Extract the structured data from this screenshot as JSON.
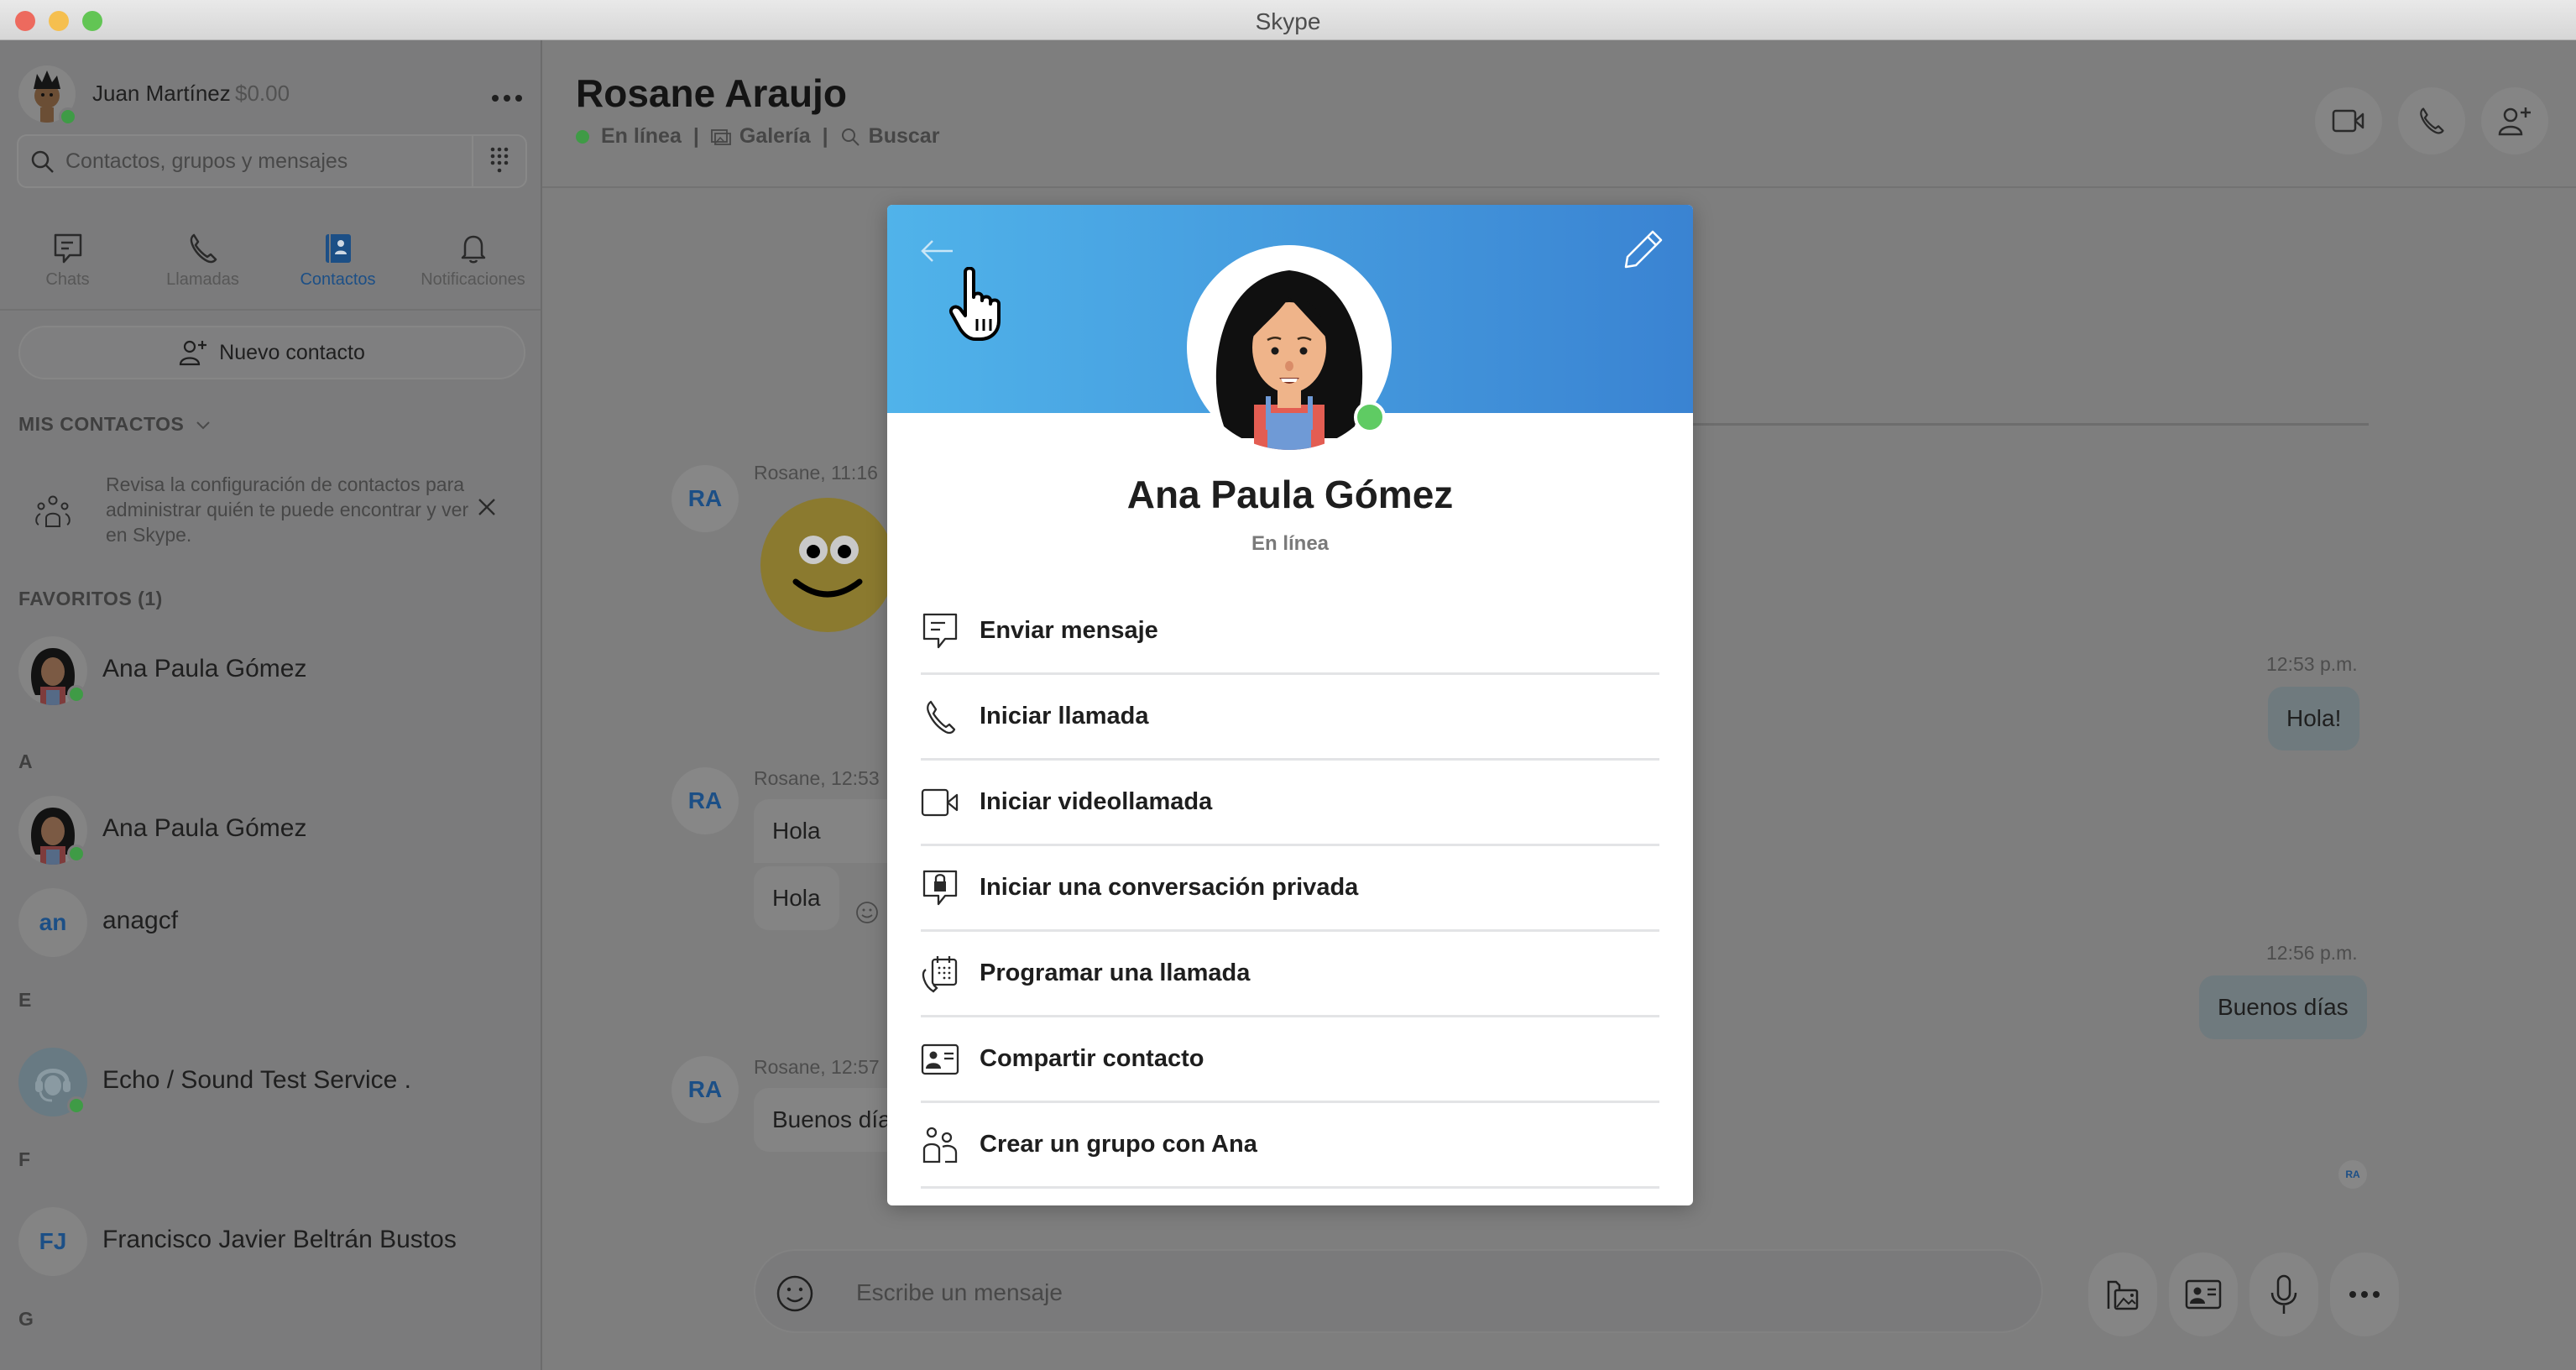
{
  "window": {
    "title": "Skype"
  },
  "sidebar": {
    "user": {
      "name": "Juan Martínez",
      "credit": "$0.00",
      "status": "online",
      "more_icon": "more-horizontal-icon"
    },
    "search": {
      "placeholder": "Contactos, grupos y mensajes",
      "value": ""
    },
    "tabs": [
      {
        "label": "Chats",
        "icon": "chat-icon",
        "active": false
      },
      {
        "label": "Llamadas",
        "icon": "phone-icon",
        "active": false
      },
      {
        "label": "Contactos",
        "icon": "contacts-book-icon",
        "active": true
      },
      {
        "label": "Notificaciones",
        "icon": "bell-icon",
        "active": false
      }
    ],
    "new_contact_label": "Nuevo contacto",
    "my_contacts_label": "MIS CONTACTOS",
    "notice_text": "Revisa la configuración de contactos para administrar quién te puede encontrar y ver en Skype.",
    "favorites_label": "FAVORITOS (1)",
    "favorites": [
      {
        "name": "Ana Paula Gómez",
        "online": true
      }
    ],
    "groups": [
      {
        "letter": "A",
        "contacts": [
          {
            "name": "Ana Paula Gómez",
            "online": true,
            "avatar": "image"
          },
          {
            "name": "anagcf",
            "online": false,
            "initials": "an"
          }
        ]
      },
      {
        "letter": "E",
        "contacts": [
          {
            "name": "Echo / Sound Test Service .",
            "online": true,
            "avatar": "headset"
          }
        ]
      },
      {
        "letter": "F",
        "contacts": [
          {
            "name": "Francisco Javier Beltrán Bustos",
            "online": false,
            "initials": "FJ"
          }
        ]
      },
      {
        "letter": "G",
        "contacts": []
      }
    ]
  },
  "chat": {
    "title": "Rosane Araujo",
    "status": "En línea",
    "gallery_label": "Galería",
    "search_label": "Buscar",
    "separator": "|",
    "header_actions": [
      "video-call",
      "audio-call",
      "add-person"
    ],
    "messages": [
      {
        "sender": "Rosane",
        "initials": "RA",
        "meta": "Rosane, 11:16",
        "type": "emoji"
      },
      {
        "sender": "me",
        "meta": "12:53 p.m.",
        "text": "Hola!"
      },
      {
        "sender": "Rosane",
        "initials": "RA",
        "meta": "Rosane, 12:53",
        "texts": [
          "Hola",
          "Hola"
        ]
      },
      {
        "sender": "me",
        "meta": "12:56 p.m.",
        "text": "Buenos días"
      },
      {
        "sender": "Rosane",
        "initials": "RA",
        "meta": "Rosane, 12:57",
        "text": "Buenos días"
      }
    ],
    "read_receipt": "RA",
    "composer_placeholder": "Escribe un mensaje"
  },
  "profile_modal": {
    "name": "Ana Paula Gómez",
    "status": "En línea",
    "actions": [
      {
        "label": "Enviar mensaje",
        "icon": "chat-icon"
      },
      {
        "label": "Iniciar llamada",
        "icon": "phone-icon"
      },
      {
        "label": "Iniciar videollamada",
        "icon": "video-icon"
      },
      {
        "label": "Iniciar una conversación privada",
        "icon": "private-chat-lock-icon"
      },
      {
        "label": "Programar una llamada",
        "icon": "schedule-call-icon"
      },
      {
        "label": "Compartir contacto",
        "icon": "contact-card-icon"
      },
      {
        "label": "Crear un grupo con Ana",
        "icon": "group-icon"
      }
    ]
  },
  "colors": {
    "accent": "#1c4f86",
    "online": "#5fcb63",
    "banner_start": "#50b3ea",
    "banner_end": "#3a83d2"
  }
}
